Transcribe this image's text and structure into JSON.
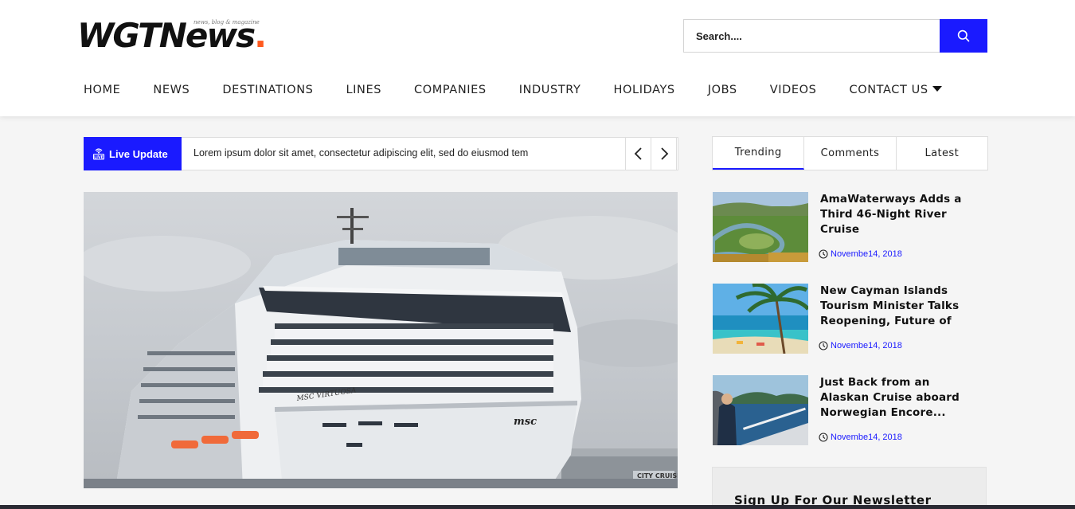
{
  "header": {
    "logo": {
      "name": "WGTNews",
      "dot": ".",
      "tagline": "news, blog & magazine"
    },
    "search": {
      "placeholder": "Search....",
      "button_icon": "search-icon"
    },
    "nav": [
      {
        "label": "HOME"
      },
      {
        "label": "NEWS"
      },
      {
        "label": "DESTINATIONS"
      },
      {
        "label": "LINES"
      },
      {
        "label": "COMPANIES"
      },
      {
        "label": "INDUSTRY"
      },
      {
        "label": "HOLIDAYS"
      },
      {
        "label": "JOBS"
      },
      {
        "label": "VIDEOS"
      },
      {
        "label": "CONTACT US",
        "icon": "caret-down-icon"
      }
    ]
  },
  "ticker": {
    "badge_label": "Live Update",
    "badge_icon": "live-broadcast-icon",
    "text": "Lorem ipsum dolor sit amet, consectetur adipiscing elit, sed do eiusmod tem",
    "prev_icon": "chevron-left-icon",
    "next_icon": "chevron-right-icon"
  },
  "hero": {
    "ship_name": "MSC VIRTUOSA",
    "logo": "msc",
    "terminal_sign": "CITY CRUISE"
  },
  "sidebar": {
    "tabs": [
      {
        "label": "Trending",
        "active": true
      },
      {
        "label": "Comments",
        "active": false
      },
      {
        "label": "Latest",
        "active": false
      }
    ],
    "items": [
      {
        "title": "AmaWaterways Adds a Third 46-Night River Cruise",
        "date": "Novembe14, 2018",
        "date_icon": "clock-icon"
      },
      {
        "title": "New Cayman Islands Tourism Minister Talks Reopening, Future of",
        "date": "Novembe14, 2018",
        "date_icon": "clock-icon"
      },
      {
        "title": "Just Back from an Alaskan Cruise aboard Norwegian Encore...",
        "date": "Novembe14, 2018",
        "date_icon": "clock-icon"
      }
    ],
    "newsletter_title": "Sign Up For Our Newsletter"
  },
  "colors": {
    "accent": "#1a1aff",
    "logo_dot": "#ff5a1f",
    "date_text": "#1a1aff"
  }
}
